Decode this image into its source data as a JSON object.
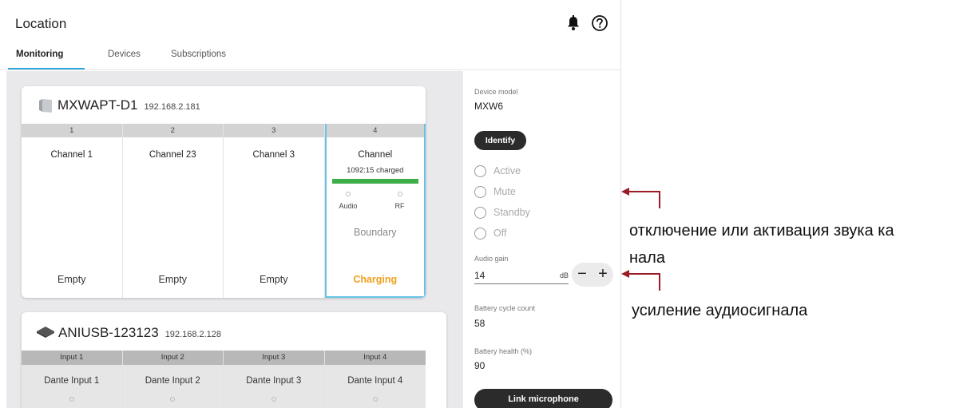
{
  "app": {
    "title": "Location",
    "icons": {
      "notifications": "bell-icon",
      "help": "help-circle-icon"
    },
    "accent_color": "#2fa7d8"
  },
  "tabs": [
    {
      "label": "Monitoring",
      "active": true
    },
    {
      "label": "Devices",
      "active": false
    },
    {
      "label": "Subscriptions",
      "active": false
    }
  ],
  "devices": [
    {
      "name": "MXWAPT-D1",
      "ip": "192.168.2.181",
      "icon": "access-point-icon",
      "channels": [
        {
          "number": "1",
          "name": "Channel 1",
          "status": "Empty"
        },
        {
          "number": "2",
          "name": "Channel 23",
          "status": "Empty"
        },
        {
          "number": "3",
          "name": "Channel 3",
          "status": "Empty"
        },
        {
          "number": "4",
          "name": "Channel",
          "selected": true,
          "charge_text": "1092:15 charged",
          "charge_level": 1.0,
          "charge_color": "#3fae49",
          "led_labels": [
            "Audio",
            "RF"
          ],
          "mic_type": "Boundary",
          "status": "Charging",
          "status_color": "#f0a01e"
        }
      ]
    },
    {
      "name": "ANIUSB-123123",
      "ip": "192.168.2.128",
      "icon": "usb-interface-icon",
      "inputs": [
        {
          "number": "Input 1",
          "name": "Dante Input 1"
        },
        {
          "number": "Input 2",
          "name": "Dante Input 2"
        },
        {
          "number": "Input 3",
          "name": "Dante Input 3"
        },
        {
          "number": "Input 4",
          "name": "Dante Input 4"
        }
      ]
    }
  ],
  "panel": {
    "device_model_label": "Device model",
    "device_model_value": "MXW6",
    "identify_label": "Identify",
    "states": [
      "Active",
      "Mute",
      "Standby",
      "Off"
    ],
    "audio_gain_label": "Audio gain",
    "audio_gain_value": "14",
    "audio_gain_unit": "dB",
    "minus": "−",
    "plus": "+",
    "battery_cycle_label": "Battery cycle count",
    "battery_cycle_value": "58",
    "battery_health_label": "Battery health (%)",
    "battery_health_value": "90",
    "link_microphone_label": "Link microphone"
  },
  "annotations": {
    "mute_line1": "отключение или активация звука ка",
    "mute_line2": "нала",
    "gain": "усиление аудиосигнала",
    "arrow_color": "#9b1c24"
  }
}
